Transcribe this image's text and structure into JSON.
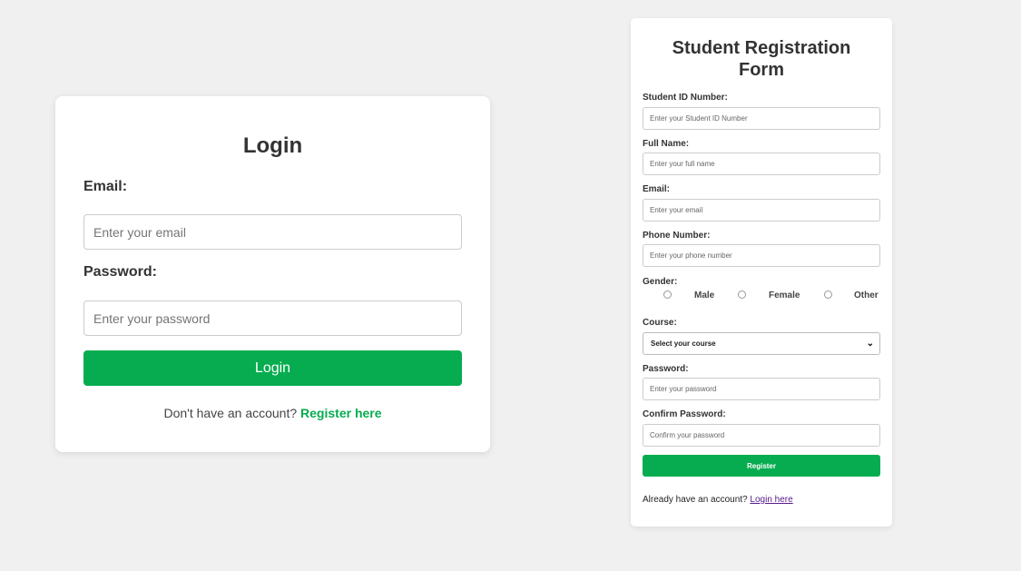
{
  "login": {
    "title": "Login",
    "email_label": "Email:",
    "email_placeholder": "Enter your email",
    "password_label": "Password:",
    "password_placeholder": "Enter your password",
    "button_label": "Login",
    "footer_text": "Don't have an account?",
    "register_link": "Register here"
  },
  "registration": {
    "title_line1": "Student Registration",
    "title_line2": "Form",
    "student_id_label": "Student ID Number:",
    "student_id_placeholder": "Enter your Student ID Number",
    "full_name_label": "Full Name:",
    "full_name_placeholder": "Enter your full name",
    "email_label": "Email:",
    "email_placeholder": "Enter your email",
    "phone_label": "Phone Number:",
    "phone_placeholder": "Enter your phone number",
    "gender_label": "Gender:",
    "gender_options": [
      "Male",
      "Female",
      "Other"
    ],
    "course_label": "Course:",
    "course_selected": "Select your course",
    "password_label": "Password:",
    "password_placeholder": "Enter your password",
    "confirm_password_label": "Confirm Password:",
    "confirm_password_placeholder": "Confirm your password",
    "button_label": "Register",
    "footer_text": "Already have an account?",
    "login_link": "Login here"
  },
  "colors": {
    "background": "#f0f0f0",
    "accent_green": "#06ac4f",
    "visited_link": "#551a8b"
  },
  "icons": {
    "select_chevron": "chevron-down-icon"
  }
}
